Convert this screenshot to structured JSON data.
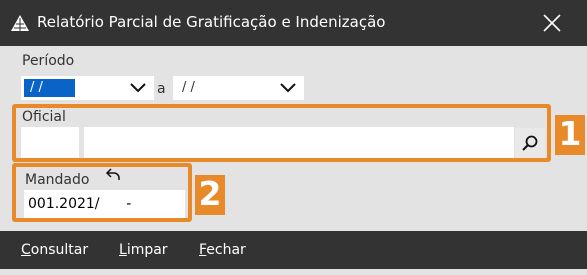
{
  "window": {
    "title": "Relatório Parcial de Gratificação e Indenização"
  },
  "periodo": {
    "label": "Período",
    "start_value": "/ /",
    "separator": "a",
    "end_value": "/ /"
  },
  "oficial": {
    "label": "Oficial",
    "code_value": "",
    "name_value": ""
  },
  "mandado": {
    "label": "Mandado",
    "value": "001.2021/      -"
  },
  "annotations": {
    "badge1": "1",
    "badge2": "2",
    "color": "#e8892a"
  },
  "footer": {
    "consultar_first": "C",
    "consultar_rest": "onsultar",
    "limpar_first": "L",
    "limpar_rest": "impar",
    "fechar_first": "F",
    "fechar_rest": "echar"
  },
  "icons": [
    "app-icon",
    "close-icon",
    "chevron-down-icon",
    "search-icon",
    "undo-icon"
  ],
  "colors": {
    "titlebar": "#333333",
    "selection": "#0a64c8",
    "accent": "#e8892a"
  }
}
